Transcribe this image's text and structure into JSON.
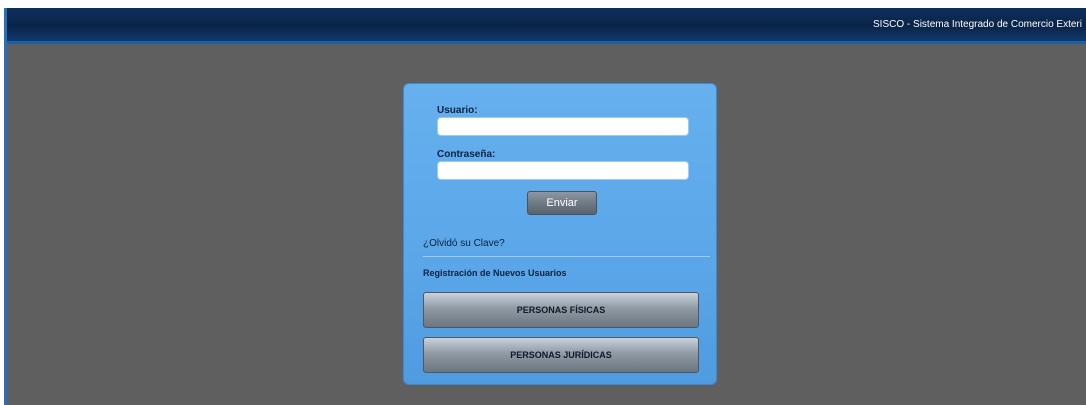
{
  "header": {
    "title": "SISCO - Sistema Integrado de Comercio Exteri"
  },
  "login": {
    "user_label": "Usuario:",
    "user_value": "",
    "password_label": "Contraseña:",
    "password_value": "",
    "submit_label": "Enviar",
    "forgot_link": "¿Olvidó su Clave?"
  },
  "registration": {
    "title": "Registración de Nuevos Usuarios",
    "buttons": [
      {
        "label": "PERSONAS FÍSICAS"
      },
      {
        "label": "PERSONAS JURÍDICAS"
      }
    ]
  },
  "colors": {
    "background": "#5f5f5f",
    "header": "#0a2448",
    "panel": "#5aa6e8",
    "button": "#6e7883"
  }
}
